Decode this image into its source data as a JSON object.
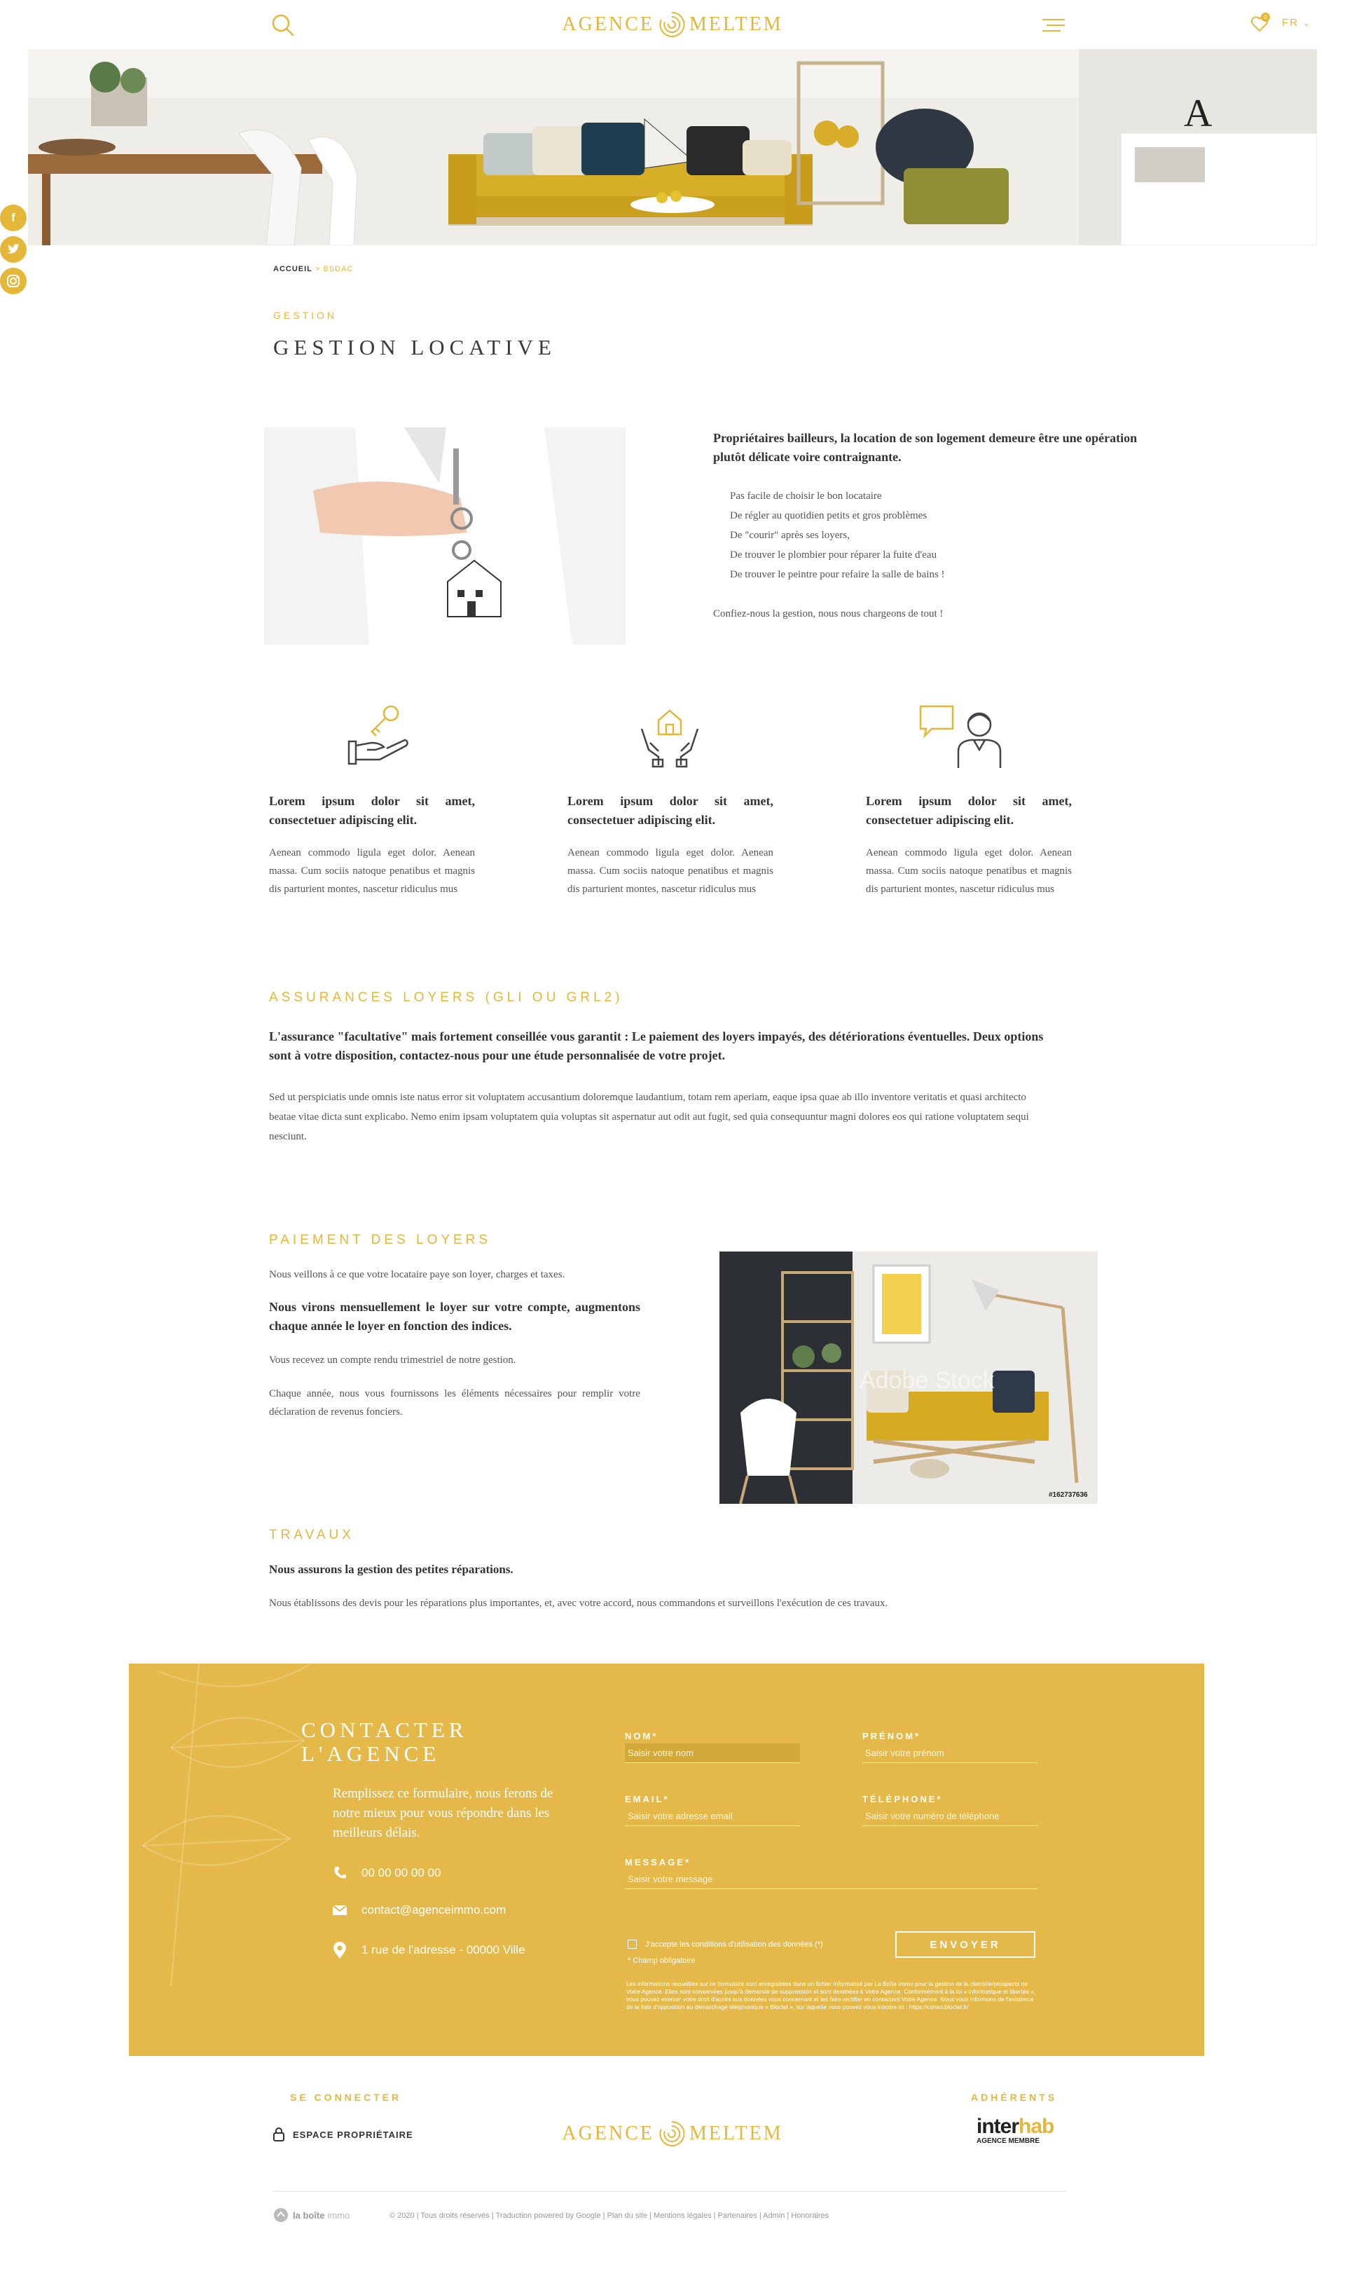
{
  "header": {
    "logo_left": "AGENCE",
    "logo_right": "MELTEM",
    "language": "FR",
    "cart_count": "0"
  },
  "breadcrumb": {
    "home": "ACCUEIL",
    "separator": ">",
    "current": "BSDAC"
  },
  "page": {
    "eyebrow": "GESTION",
    "title": "GESTION LOCATIVE"
  },
  "intro": {
    "lead": "Propriétaires bailleurs, la location de son logement demeure être une opération plutôt délicate voire contraignante.",
    "lines": [
      "Pas facile de choisir le bon locataire",
      "De régler au quotidien petits et gros problèmes",
      "De \"courir\" après ses loyers,",
      "De trouver le plombier pour réparer la fuite d'eau",
      "De trouver le peintre pour refaire la salle de bains !"
    ],
    "closing": "Confiez-nous la gestion, nous nous chargeons de tout !"
  },
  "features": [
    {
      "icon": "hand-key-icon",
      "title": "Lorem ipsum dolor sit amet, consectetuer adipiscing elit.",
      "text": "Aenean commodo ligula eget dolor. Aenean massa. Cum sociis natoque penatibus et magnis dis parturient montes, nascetur ridiculus mus"
    },
    {
      "icon": "hands-house-icon",
      "title": "Lorem ipsum dolor sit amet, consectetuer adipiscing elit.",
      "text": "Aenean commodo ligula eget dolor. Aenean massa. Cum sociis natoque penatibus et magnis dis parturient montes, nascetur ridiculus mus"
    },
    {
      "icon": "agent-chat-icon",
      "title": "Lorem ipsum dolor sit amet, consectetuer adipiscing elit.",
      "text": "Aenean commodo ligula eget dolor. Aenean massa. Cum sociis natoque penatibus et magnis dis parturient montes, nascetur ridiculus mus"
    }
  ],
  "assurances": {
    "title": "ASSURANCES LOYERS (GLI OU GRL2)",
    "lead": "L'assurance \"facultative\" mais fortement conseillée vous garantit : Le paiement des loyers impayés, des détériorations éventuelles. Deux options sont à votre disposition, contactez-nous pour une étude personnalisée de votre projet.",
    "text": "Sed ut perspiciatis unde omnis iste natus error sit voluptatem accusantium doloremque laudantium, totam rem aperiam, eaque ipsa quae ab illo inventore veritatis et quasi architecto beatae vitae dicta sunt explicabo. Nemo enim ipsam voluptatem quia voluptas sit aspernatur aut odit aut fugit, sed quia consequuntur magni dolores eos qui ratione voluptatem sequi nesciunt."
  },
  "paiement": {
    "title": "PAIEMENT DES LOYERS",
    "p1": "Nous veillons à ce que votre locataire paye son loyer, charges et taxes.",
    "lead": "Nous virons mensuellement le loyer sur votre compte, augmentons chaque année le loyer en fonction des indices.",
    "p2": "Vous recevez un compte rendu trimestriel de notre gestion.",
    "p3": "Chaque année, nous vous fournissons les éléments nécessaires pour remplir votre déclaration de revenus fonciers.",
    "image_watermark": "Adobe Stock",
    "image_id": "#162737636"
  },
  "travaux": {
    "title": "TRAVAUX",
    "lead": "Nous assurons la gestion des petites réparations.",
    "text": "Nous établissons des devis pour les réparations plus importantes, et, avec votre accord, nous commandons et surveillons l'exécution de ces travaux."
  },
  "contact": {
    "title_line1": "CONTACTER",
    "title_line2": "L'AGENCE",
    "intro": "Remplissez ce formulaire, nous ferons de notre mieux pour vous répondre dans les meilleurs délais.",
    "phone": "00 00 00 00 00",
    "email": "contact@agenceimmo.com",
    "address": "1 rue de l'adresse - 00000 Ville",
    "fields": {
      "nom_label": "NOM*",
      "nom_placeholder": "Saisir votre nom",
      "prenom_label": "PRÉNOM*",
      "prenom_placeholder": "Saisir votre prénom",
      "email_label": "EMAIL*",
      "email_placeholder": "Saisir votre adresse email",
      "tel_label": "TÉLÉPHONE*",
      "tel_placeholder": "Saisir votre numéro de téléphone",
      "message_label": "MESSAGE*",
      "message_placeholder": "Saisir votre message"
    },
    "consent": "J'accepte les conditions d'utilisation des données (*)",
    "required_note": "* Champ obligatoire",
    "legal": "Les informations recueillies sur ce formulaire sont enregistrées dans un fichier informatisé par La Boîte Immo pour la gestion de la clientèle/prospects de Votre Agence. Elles sont conservées jusqu'à demande de suppression et sont destinées à Votre Agence. Conformément à la loi « informatique et libertés », vous pouvez exercer votre droit d'accès aux données vous concernant et les faire rectifier en contactant Votre Agence. Nous vous informons de l'existence de la liste d'opposition au démarchage téléphonique « Bloctel », sur laquelle vous pouvez vous inscrire ici : https://conso.bloctel.fr/",
    "send": "ENVOYER"
  },
  "footer": {
    "connect_label": "SE CONNECTER",
    "owner_space": "ESPACE PROPRIÉTAIRE",
    "members_label": "ADHÉRENTS",
    "interhab_a": "inter",
    "interhab_b": "hab",
    "interhab_sub": "AGENCE MEMBRE",
    "laboite_a": "la boîte",
    "laboite_b": "immo",
    "meta": "© 2020 | Tous droits réservés | Traduction powered by Google | Plan du site | Mentions légales | Partenaires | Admin | Honoraires"
  },
  "colors": {
    "accent": "#e4b739",
    "contact_bg": "#e4b94a",
    "text": "#333333"
  }
}
